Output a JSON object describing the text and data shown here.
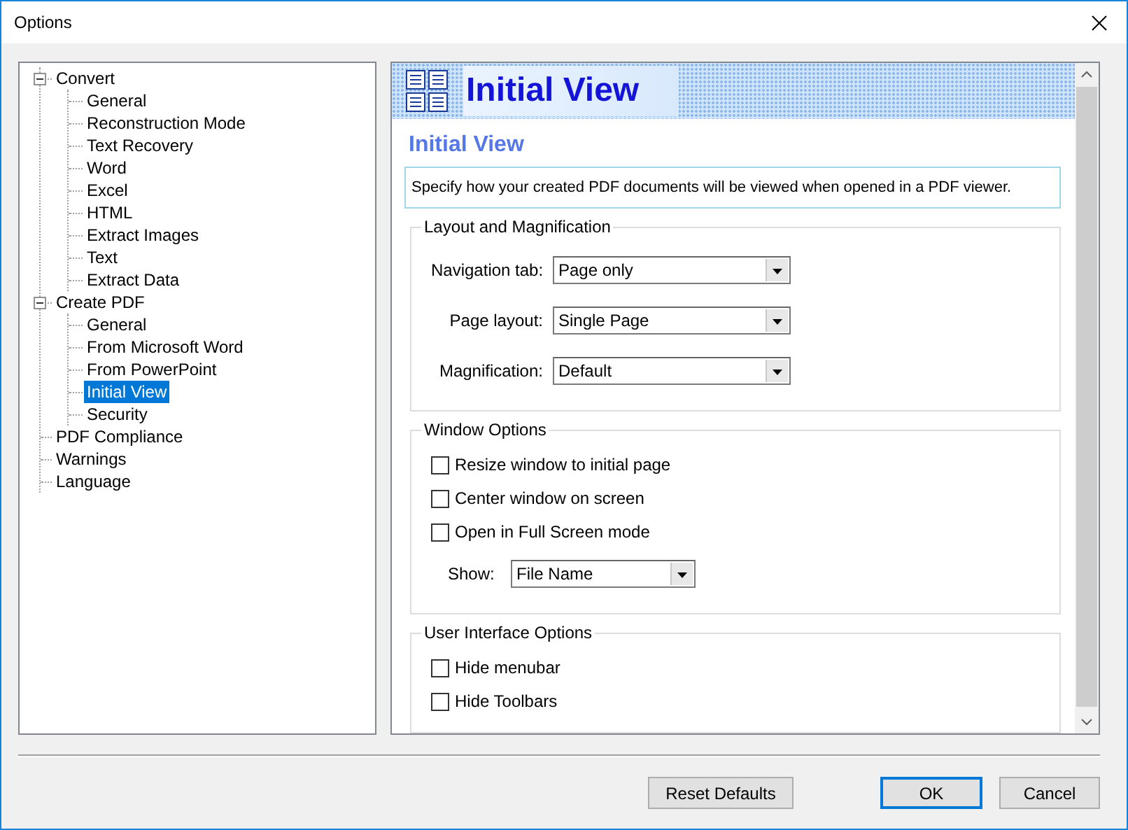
{
  "window": {
    "title": "Options"
  },
  "tree": [
    {
      "label": "Convert",
      "expanded": true,
      "selected": false,
      "children": [
        {
          "label": "General",
          "selected": false
        },
        {
          "label": "Reconstruction Mode",
          "selected": false
        },
        {
          "label": "Text Recovery",
          "selected": false
        },
        {
          "label": "Word",
          "selected": false
        },
        {
          "label": "Excel",
          "selected": false
        },
        {
          "label": "HTML",
          "selected": false
        },
        {
          "label": "Extract Images",
          "selected": false
        },
        {
          "label": "Text",
          "selected": false
        },
        {
          "label": "Extract Data",
          "selected": false
        }
      ]
    },
    {
      "label": "Create PDF",
      "expanded": true,
      "selected": false,
      "children": [
        {
          "label": "General",
          "selected": false
        },
        {
          "label": "From Microsoft Word",
          "selected": false
        },
        {
          "label": "From PowerPoint",
          "selected": false
        },
        {
          "label": "Initial View",
          "selected": true
        },
        {
          "label": "Security",
          "selected": false
        }
      ]
    },
    {
      "label": "PDF Compliance",
      "selected": false
    },
    {
      "label": "Warnings",
      "selected": false
    },
    {
      "label": "Language",
      "selected": false
    }
  ],
  "page": {
    "banner_title": "Initial View",
    "heading": "Initial View",
    "description": "Specify how your created PDF documents will be viewed when opened in a PDF viewer.",
    "groups": [
      {
        "title": "Layout and Magnification",
        "items": [
          {
            "kind": "dropdown",
            "label": "Navigation tab:",
            "value": "Page only"
          },
          {
            "kind": "dropdown",
            "label": "Page layout:",
            "value": "Single Page"
          },
          {
            "kind": "dropdown",
            "label": "Magnification:",
            "value": "Default"
          }
        ]
      },
      {
        "title": "Window Options",
        "items": [
          {
            "kind": "checkbox",
            "label": "Resize window to initial page",
            "checked": false
          },
          {
            "kind": "checkbox",
            "label": "Center window on screen",
            "checked": false
          },
          {
            "kind": "checkbox",
            "label": "Open in Full Screen mode",
            "checked": false
          },
          {
            "kind": "inline_dropdown",
            "label": "Show:",
            "value": "File Name"
          }
        ]
      },
      {
        "title": "User Interface Options",
        "items": [
          {
            "kind": "checkbox",
            "label": "Hide menubar",
            "checked": false
          },
          {
            "kind": "checkbox",
            "label": "Hide Toolbars",
            "checked": false
          }
        ]
      }
    ]
  },
  "buttons": [
    {
      "label": "Reset Defaults",
      "default": false
    },
    {
      "label": "OK",
      "default": true
    },
    {
      "label": "Cancel",
      "default": false
    }
  ]
}
